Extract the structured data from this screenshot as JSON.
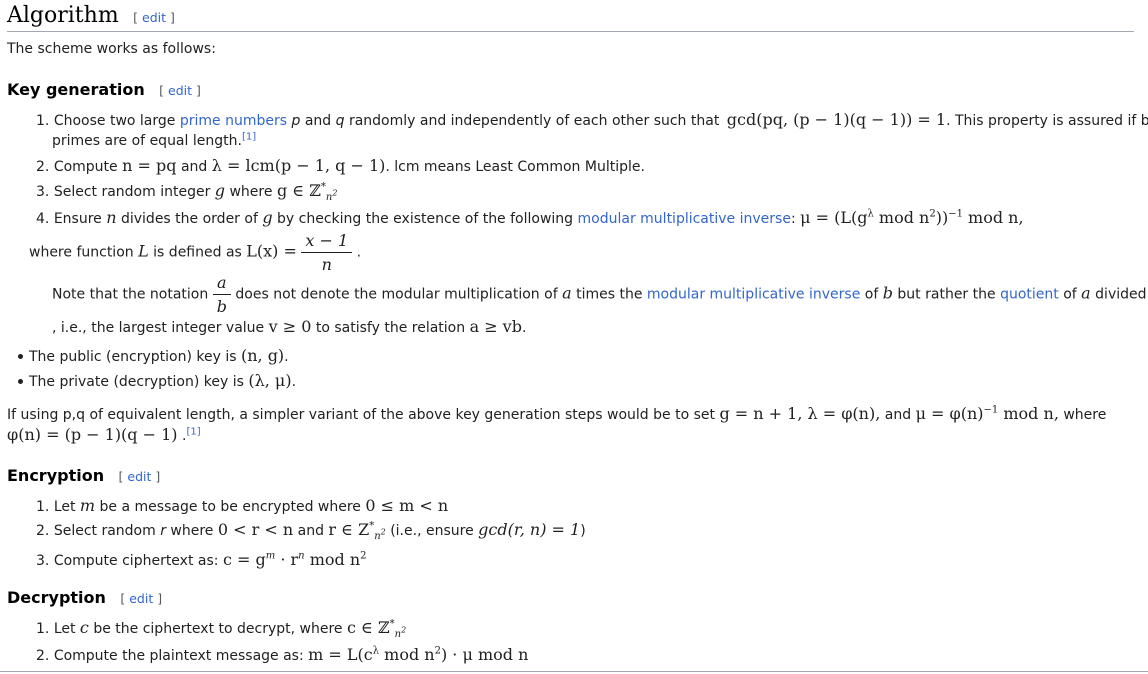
{
  "algorithm": {
    "title": "Algorithm",
    "edit": "edit",
    "intro": "The scheme works as follows:"
  },
  "keygen": {
    "title": "Key generation",
    "edit": "edit",
    "item1": {
      "num": "1.",
      "pre": "Choose two large",
      "link": "prime numbers",
      "mid": "and",
      "post": "randomly and independently of each other such that",
      "math": "gcd(pq, (p − 1)(q − 1)) = 1",
      "after": ". This property is assured if both",
      "line2": "primes are of equal length.",
      "ref": "[1]"
    },
    "item2": {
      "num": "2.",
      "pre": "Compute",
      "m1": "n = pq",
      "and": "and",
      "m2": "λ = lcm(p − 1, q − 1)",
      "post": ". lcm means Least Common Multiple."
    },
    "item3": {
      "num": "3.",
      "pre": "Select random integer",
      "g": "g",
      "where": "where",
      "m": "g ∈ ℤ"
    },
    "item4": {
      "num": "4.",
      "pre": "Ensure",
      "mid": "divides the order of",
      "mid2": "by checking the existence of the following",
      "link": "modular multiplicative inverse",
      "colon": ":",
      "math": "μ = (L(g",
      "math2": "mod n",
      "math3": "))",
      "math4": "mod n,"
    },
    "where_L": {
      "pre": "where function",
      "mid": "is defined as",
      "lhs": "L(x) =",
      "num": "x − 1",
      "den": "n",
      "end": "."
    },
    "note": {
      "pre": "Note that the notation",
      "fnum": "a",
      "fden": "b",
      "mid": "does not denote the modular multiplication of",
      "times": "times the",
      "link1": "modular multiplicative inverse",
      "of": "of",
      "but": "but rather the",
      "link2": "quotient",
      "divby": "divided by",
      "line2a": ", i.e., the largest integer value",
      "ineq": "v ≥ 0",
      "line2b": "to satisfy the relation",
      "rel": "a ≥ vb",
      "end": "."
    },
    "public_key": {
      "text": "The public (encryption) key is",
      "math": "(n, g)",
      "end": "."
    },
    "private_key": {
      "text": "The private (decryption) key is",
      "math": "(λ, μ)",
      "end": "."
    },
    "variant": {
      "pre": "If using p,q of equivalent length, a simpler variant of the above key generation steps would be to set",
      "math": "g = n + 1, λ = φ(n),",
      "and": "and",
      "math2": "μ = φ(n)",
      "math3": "mod n,",
      "where": "where",
      "line2": "φ(n) = (p − 1)(q − 1)",
      "end": ".",
      "ref": "[1]"
    }
  },
  "encryption": {
    "title": "Encryption",
    "edit": "edit",
    "item1": {
      "num": "1.",
      "pre": "Let",
      "m": "m",
      "mid": "be a message to be encrypted where",
      "math": "0 ≤ m < n"
    },
    "item2": {
      "num": "2.",
      "pre": "Select random",
      "r": "r",
      "where": "where",
      "m1": "0 < r < n",
      "and": "and",
      "m2": "r ∈ Z",
      "paren": "(i.e., ensure",
      "m3": "gcd(r, n) = 1",
      "close": ")"
    },
    "item3": {
      "num": "3.",
      "pre": "Compute ciphertext as:",
      "math": "c = g",
      "dot": "· r",
      "mod": "mod n"
    }
  },
  "decryption": {
    "title": "Decryption",
    "edit": "edit",
    "item1": {
      "num": "1.",
      "pre": "Let",
      "c": "c",
      "mid": "be the ciphertext to decrypt, where",
      "math": "c ∈ ℤ"
    },
    "item2": {
      "num": "2.",
      "pre": "Compute the plaintext message as:",
      "math": "m = L(c",
      "mod": "mod n",
      "close": ") · μ mod n"
    }
  },
  "script_symbols": {
    "star": "*",
    "n2sub": "n",
    "two": "2",
    "lambda": "λ",
    "neg1": "−1",
    "m": "m",
    "n": "n",
    "p": "p",
    "q": "q",
    "L": "L",
    "g": "g",
    "a": "a",
    "b": "b"
  }
}
